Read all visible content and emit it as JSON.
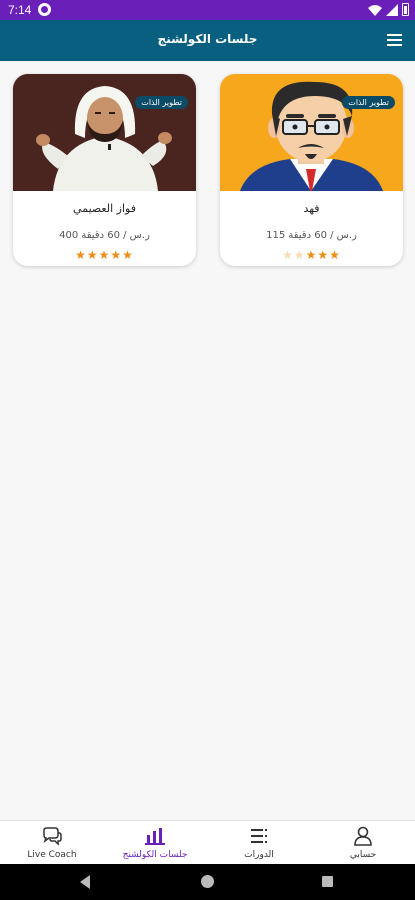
{
  "status_bar": {
    "time": "7:14",
    "colors": {
      "background": "#6a1fb8"
    }
  },
  "app_bar": {
    "title": "جلسات الكولشنج",
    "menu_icon": "hamburger-menu-icon",
    "colors": {
      "background": "#085f7f"
    }
  },
  "coaches": [
    {
      "name": "فهد",
      "tag": "تطوير الذات",
      "price_duration": "115 ر.س / 60 دقيقة",
      "rating": 3,
      "max_rating": 5,
      "image": "cartoon-man-with-glasses-avatar"
    },
    {
      "name": "فواز العصيمي",
      "tag": "تطوير الذات",
      "price_duration": "400 ر.س / 60 دقيقة",
      "rating": 5,
      "max_rating": 5,
      "image": "man-in-white-thobe-speaking-photo"
    }
  ],
  "bottom_nav": [
    {
      "label": "حسابي",
      "icon": "person-icon",
      "active": false
    },
    {
      "label": "الدورات",
      "icon": "list-icon",
      "active": false
    },
    {
      "label": "جلسات الكولشنج",
      "icon": "chart-people-icon",
      "active": true
    },
    {
      "label": "Live Coach",
      "icon": "chat-bubbles-icon",
      "active": false
    }
  ],
  "colors": {
    "accent": "#6a1fb8",
    "star": "#f08c16",
    "tag": "#0b4b66"
  }
}
